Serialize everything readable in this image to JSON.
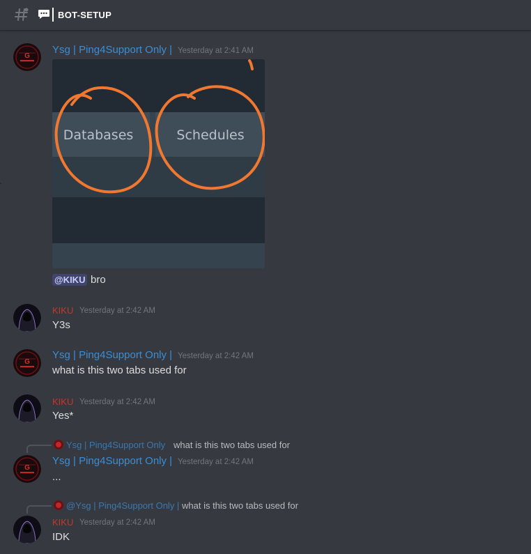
{
  "channel": {
    "name": "BOT-SETUP"
  },
  "messages": [
    {
      "author": "Ysg | Ping4Support Only |",
      "timestamp": "Yesterday at 2:41 AM",
      "attachment": {
        "tabs": [
          "Databases",
          "Schedules"
        ]
      },
      "mention": "@KIKU",
      "text": "bro"
    },
    {
      "author": "KIKU",
      "timestamp": "Yesterday at 2:42 AM",
      "text": "Y3s"
    },
    {
      "author": "Ysg | Ping4Support Only |",
      "timestamp": "Yesterday at 2:42 AM",
      "text": "what is this two tabs used for"
    },
    {
      "author": "KIKU",
      "timestamp": "Yesterday at 2:42 AM",
      "text": "Yes*"
    },
    {
      "reply": {
        "author": "Ysg | Ping4Support Only",
        "text": "what is this two tabs used for"
      },
      "author": "Ysg | Ping4Support Only |",
      "timestamp": "Yesterday at 2:42 AM",
      "text": "..."
    },
    {
      "reply": {
        "author": "@Ysg | Ping4Support Only |",
        "text": "what is this two tabs used for"
      },
      "author": "KIKU",
      "timestamp": "Yesterday at 2:42 AM",
      "text": "IDK"
    }
  ],
  "colors": {
    "background": "#36393f",
    "ysg_name": "#3b8ed6",
    "kiku_name": "#c0392b",
    "timestamp": "#72767d",
    "mention_bg": "#41456b",
    "annotation_orange": "#f07830"
  },
  "icons": [
    "hash-icon",
    "speech-bubble-icon"
  ]
}
